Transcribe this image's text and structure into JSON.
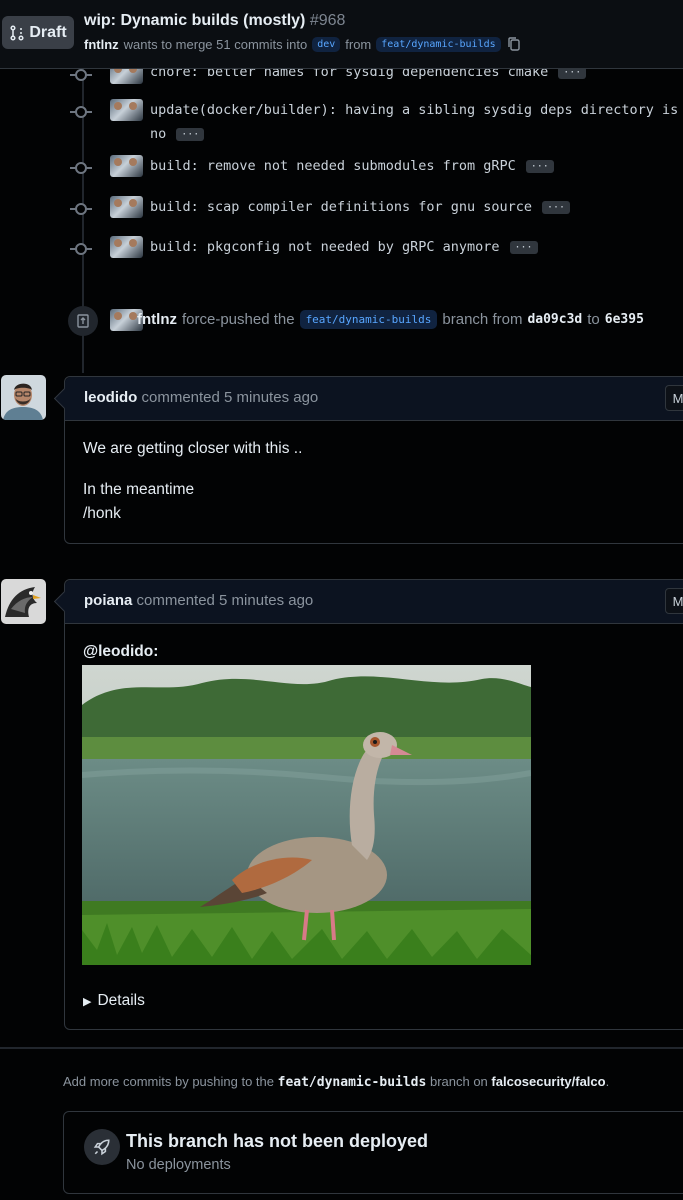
{
  "header": {
    "draft_label": "Draft",
    "title": "wip: Dynamic builds (mostly)",
    "number": "#968",
    "author": "fntlnz",
    "merge_text": "wants to merge 51 commits into",
    "base_branch": "dev",
    "from_text": "from",
    "head_branch": "feat/dynamic-builds"
  },
  "commits": [
    {
      "message": "chore: better names for sysdig dependencies cmake"
    },
    {
      "message": "update(docker/builder): having a sibling sysdig deps directory is",
      "message_cont": "no"
    },
    {
      "message": "build: remove not needed submodules from gRPC"
    },
    {
      "message": "build: scap compiler definitions for gnu source"
    },
    {
      "message": "build: pkgconfig not needed by gRPC anymore"
    }
  ],
  "more_label": "···",
  "force_push": {
    "user": "fntlnz",
    "action": "force-pushed the",
    "branch": "feat/dynamic-builds",
    "mid": "branch from",
    "from_sha": "da09c3d",
    "to": "to",
    "to_sha": "6e395"
  },
  "comments": [
    {
      "user": "leodido",
      "meta": "commented 5 minutes ago",
      "menu_label": "M",
      "lines": [
        "We are getting closer with this ..",
        "In the meantime",
        "/honk"
      ]
    },
    {
      "user": "poiana",
      "meta": "commented 5 minutes ago",
      "menu_label": "M",
      "mention": "@leodido:",
      "details_label": "Details"
    }
  ],
  "push_hint": {
    "prefix": "Add more commits by pushing to the",
    "branch": "feat/dynamic-builds",
    "mid": "branch on",
    "repo": "falcosecurity/falco",
    "suffix": "."
  },
  "deployment": {
    "title": "This branch has not been deployed",
    "subtitle": "No deployments"
  }
}
